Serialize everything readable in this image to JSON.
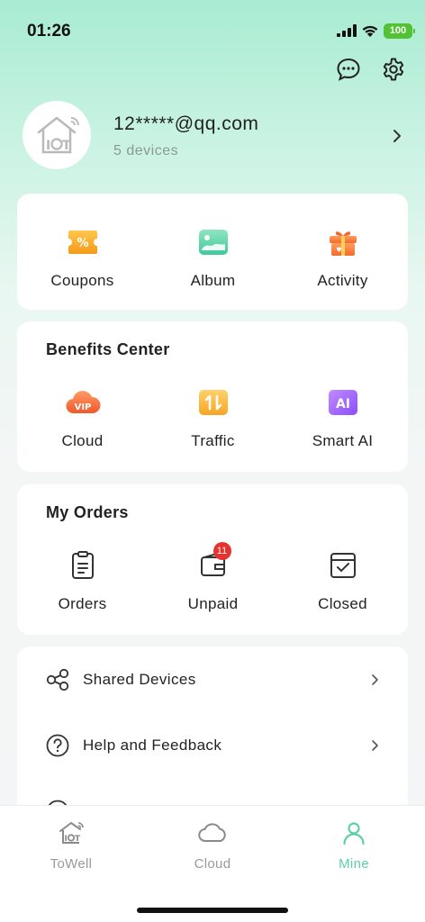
{
  "status_bar": {
    "time": "01:26",
    "battery": "100"
  },
  "profile": {
    "email": "12*****@qq.com",
    "devices": "5 devices"
  },
  "quick_actions": [
    {
      "label": "Coupons",
      "icon": "coupon-icon"
    },
    {
      "label": "Album",
      "icon": "album-icon"
    },
    {
      "label": "Activity",
      "icon": "gift-icon"
    }
  ],
  "benefits": {
    "title": "Benefits Center",
    "items": [
      {
        "label": "Cloud",
        "icon": "vip-cloud-icon",
        "icon_text": "VIP"
      },
      {
        "label": "Traffic",
        "icon": "traffic-icon"
      },
      {
        "label": "Smart AI",
        "icon": "ai-icon",
        "icon_text": "AI"
      }
    ]
  },
  "orders": {
    "title": "My Orders",
    "items": [
      {
        "label": "Orders",
        "icon": "clipboard-icon"
      },
      {
        "label": "Unpaid",
        "icon": "wallet-icon",
        "badge": "11"
      },
      {
        "label": "Closed",
        "icon": "closed-box-icon"
      }
    ]
  },
  "menu": [
    {
      "label": "Shared Devices",
      "icon": "share-icon"
    },
    {
      "label": "Help and Feedback",
      "icon": "help-icon"
    },
    {
      "label": "",
      "icon": "info-icon"
    }
  ],
  "tabs": [
    {
      "label": "ToWell",
      "icon": "home-iot-icon",
      "active": false
    },
    {
      "label": "Cloud",
      "icon": "cloud-icon",
      "active": false
    },
    {
      "label": "Mine",
      "icon": "user-icon",
      "active": true
    }
  ],
  "colors": {
    "accent": "#5fcfa4",
    "badge": "#e8322e",
    "battery": "#52c234"
  }
}
